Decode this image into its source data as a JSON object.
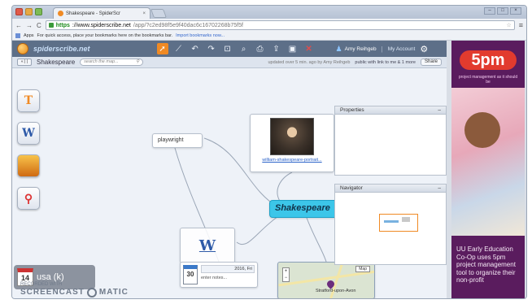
{
  "browser": {
    "tab_title": "Shakespeare - SpiderScr",
    "tab_close": "×",
    "nav": {
      "back": "←",
      "forward": "→",
      "reload": "C"
    },
    "url_scheme": "https",
    "url_host": "://www.spiderscribe.net",
    "url_path": "/app/?c2ed98f5e9f40dac6c16702268b75f5f",
    "bookmarks_apps": "Apps",
    "bookmarks_hint": "For quick access, place your bookmarks here on the bookmarks bar.",
    "bookmarks_import": "Import bookmarks now...",
    "window_controls": [
      "–",
      "□",
      "×"
    ]
  },
  "app": {
    "logo_text": "spiderscribe.net",
    "user_name": "Amy Reihgeb",
    "my_account": "My Account",
    "back_label": "« | |",
    "map_title": "Shakespeare",
    "search_placeholder": "search the map...",
    "updated_text": "updated over 5 min. ago by Amy Reihgeb",
    "shared_text": "public with link to me & 1 more",
    "share_label": "Share",
    "calendar_tooltip": "usa (k)",
    "calendar_day": "14",
    "watermark_line1": "RECORDED WITH",
    "watermark_line2": "SCREENCAST",
    "watermark_line3": "MATIC"
  },
  "nodes": {
    "playwright": "playwright",
    "portrait_caption": "william-shakespeare-portrait...",
    "center": "Shakespeare",
    "event_day": "30",
    "event_date": "2016, Fri",
    "event_notes": "enter notes...",
    "map_type": "Map",
    "map_place": "Stratford-upon-Avon"
  },
  "panels": {
    "properties_title": "Properties",
    "navigator_title": "Navigator",
    "collapse": "–"
  },
  "ad": {
    "logo": "5pm",
    "tagline": "project management as it should be",
    "caption": "UU Early Education Co-Op uses 5pm project management tool to organize their non-profit"
  },
  "colors": {
    "accent_orange": "#f08a24",
    "center_node": "#3cc6e9",
    "toolbar": "#5d6f88",
    "ad_bg": "#5a1c5e"
  }
}
